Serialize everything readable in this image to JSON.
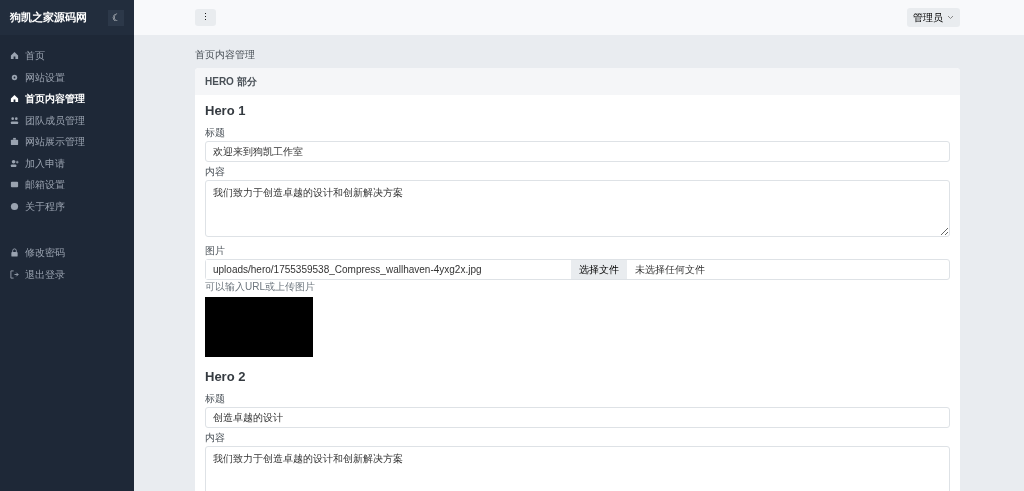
{
  "brand": "狗凯之家源码网",
  "theme_toggle": "☾",
  "sidebar": {
    "items": [
      {
        "label": "首页",
        "selected": false
      },
      {
        "label": "网站设置",
        "selected": false
      },
      {
        "label": "首页内容管理",
        "selected": true
      },
      {
        "label": "团队成员管理",
        "selected": false
      },
      {
        "label": "网站展示管理",
        "selected": false
      },
      {
        "label": "加入申请",
        "selected": false
      },
      {
        "label": "邮箱设置",
        "selected": false
      },
      {
        "label": "关于程序",
        "selected": false
      }
    ],
    "bottom_items": [
      {
        "label": "修改密码",
        "selected": false
      },
      {
        "label": "退出登录",
        "selected": false
      }
    ]
  },
  "topbar": {
    "menu_button": "⋮",
    "user": "管理员"
  },
  "page_title": "首页内容管理",
  "card": {
    "header": "HERO 部分",
    "heroes": [
      {
        "title": "Hero 1",
        "fields": [
          {
            "kind": "input",
            "label": "标题",
            "value": "欢迎来到狗凯工作室"
          },
          {
            "kind": "textarea",
            "label": "内容",
            "value": "我们致力于创造卓越的设计和创新解决方案"
          },
          {
            "kind": "image",
            "label": "图片",
            "value": "uploads/hero/1755359538_Compress_wallhaven-4yxg2x.jpg",
            "file_button": "选择文件",
            "file_status": "未选择任何文件",
            "help": "可以输入URL或上传图片"
          }
        ]
      },
      {
        "title": "Hero 2",
        "fields": [
          {
            "kind": "input",
            "label": "标题",
            "value": "创造卓越的设计"
          },
          {
            "kind": "textarea",
            "label": "内容",
            "value": "我们致力于创造卓越的设计和创新解决方案"
          }
        ]
      }
    ]
  }
}
